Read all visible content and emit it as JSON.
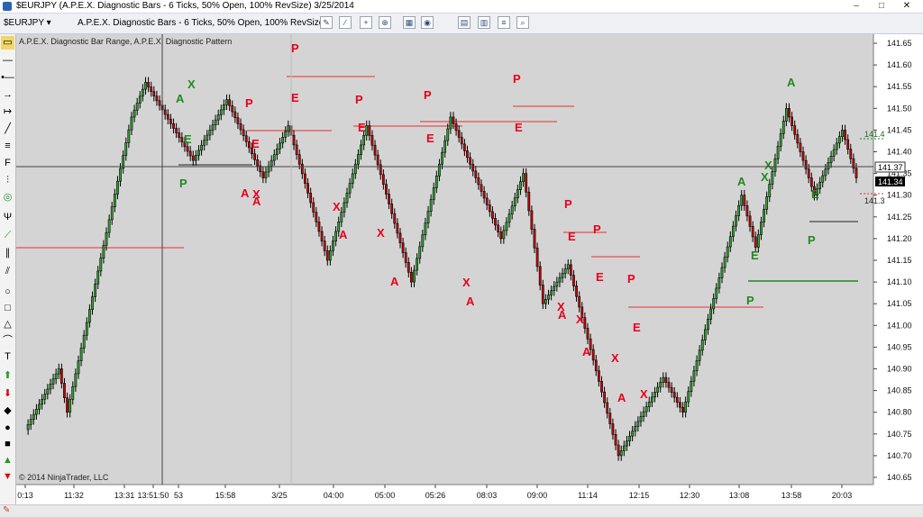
{
  "window": {
    "title": "$EURJPY (A.P.E.X. Diagnostic Bars - 6 Ticks, 50% Open, 100% RevSize)  3/25/2014",
    "minimize": "–",
    "maximize": "□",
    "close": "✕"
  },
  "toolbar": {
    "instrument": "$EURJPY",
    "bar_type": "A.P.E.X. Diagnostic Bars - 6 Ticks, 50% Open, 100% RevSize",
    "dropdown_glyph": "▾",
    "icons": [
      "pencil-icon",
      "wand-icon",
      "crosshair-icon",
      "zoom-icon",
      "data-box-icon",
      "chart-properties-icon",
      "indicators-icon",
      "strategies-icon",
      "lines-icon",
      "magnifier-icon"
    ]
  },
  "sidebar": {
    "tools": [
      "folder-icon",
      "horizontal-line-icon",
      "dots-line-icon",
      "arrow-right-icon",
      "ray-icon",
      "line-icon",
      "equals-icon",
      "fibonacci-icon",
      "gann-fan-icon",
      "circle-target-icon",
      "andrews-pitchfork-icon",
      "regression-channel-icon",
      "parallel-lines-icon",
      "double-line-icon",
      "ellipse-icon",
      "rectangle-icon",
      "triangle-icon",
      "arc-icon",
      "text-icon",
      "arrow-up-icon",
      "arrow-down-icon",
      "diamond-icon",
      "dot-icon",
      "square-icon",
      "triangle-up-icon",
      "triangle-down-icon"
    ]
  },
  "chart": {
    "indicator_label": "A.P.E.X. Diagnostic Bar Range, A.P.E.X. Diagnostic Pattern",
    "copyright": "© 2014 NinjaTrader, LLC",
    "current_price": "141.37",
    "last_price": "141.34",
    "level_label_1": "141.4",
    "level_label_2": "141.3",
    "colors": {
      "background": "#d4d4d4",
      "bull": "#2ea82e",
      "bear": "#cc0000",
      "red_label": "#e8001c",
      "green_label": "#1f8a1f"
    }
  },
  "chart_data": {
    "type": "candlestick",
    "price_axis_ticks": [
      "141.65",
      "141.60",
      "141.55",
      "141.50",
      "141.45",
      "141.40",
      "141.35",
      "141.30",
      "141.25",
      "141.20",
      "141.15",
      "141.10",
      "141.05",
      "141.00",
      "140.95",
      "140.90",
      "140.85",
      "140.80",
      "140.75",
      "140.70",
      "140.65"
    ],
    "time_axis_ticks": [
      "0:13",
      "11:32",
      "13:31",
      "13:51:50",
      "53",
      "15:58",
      "3/25",
      "04:00",
      "05:00",
      "05:26",
      "08:03",
      "09:00",
      "11:14",
      "12:15",
      "12:30",
      "13:08",
      "13:58",
      "20:03"
    ],
    "ylim": [
      140.63,
      141.67
    ],
    "pivots": [
      [
        0,
        140.76
      ],
      [
        12,
        140.9
      ],
      [
        15,
        140.8
      ],
      [
        38,
        141.48
      ],
      [
        43,
        141.56
      ],
      [
        60,
        141.38
      ],
      [
        72,
        141.52
      ],
      [
        85,
        141.34
      ],
      [
        94,
        141.46
      ],
      [
        108,
        141.15
      ],
      [
        122,
        141.46
      ],
      [
        138,
        141.1
      ],
      [
        152,
        141.48
      ],
      [
        170,
        141.2
      ],
      [
        178,
        141.35
      ],
      [
        185,
        141.05
      ],
      [
        194,
        141.14
      ],
      [
        212,
        140.7
      ],
      [
        228,
        140.88
      ],
      [
        235,
        140.8
      ],
      [
        256,
        141.3
      ],
      [
        261,
        141.18
      ],
      [
        272,
        141.5
      ],
      [
        282,
        141.3
      ],
      [
        292,
        141.45
      ],
      [
        297,
        141.34
      ]
    ],
    "labels": [
      {
        "t": "P",
        "c": "red",
        "x": 305,
        "y": 20
      },
      {
        "t": "A",
        "c": "green",
        "x": 177,
        "y": 76
      },
      {
        "t": "X",
        "c": "green",
        "x": 190,
        "y": 60
      },
      {
        "t": "E",
        "c": "green",
        "x": 186,
        "y": 121
      },
      {
        "t": "P",
        "c": "green",
        "x": 181,
        "y": 170
      },
      {
        "t": "P",
        "c": "red",
        "x": 254,
        "y": 81
      },
      {
        "t": "E",
        "c": "red",
        "x": 261,
        "y": 126
      },
      {
        "t": "A",
        "c": "red",
        "x": 249,
        "y": 181
      },
      {
        "t": "X",
        "c": "red",
        "x": 262,
        "y": 182
      },
      {
        "t": "A",
        "c": "red",
        "x": 262,
        "y": 190
      },
      {
        "t": "E",
        "c": "red",
        "x": 305,
        "y": 75
      },
      {
        "t": "P",
        "c": "red",
        "x": 376,
        "y": 77
      },
      {
        "t": "E",
        "c": "red",
        "x": 379,
        "y": 108
      },
      {
        "t": "X",
        "c": "red",
        "x": 351,
        "y": 196
      },
      {
        "t": "A",
        "c": "red",
        "x": 358,
        "y": 227
      },
      {
        "t": "P",
        "c": "red",
        "x": 452,
        "y": 72
      },
      {
        "t": "E",
        "c": "red",
        "x": 455,
        "y": 120
      },
      {
        "t": "X",
        "c": "red",
        "x": 400,
        "y": 225
      },
      {
        "t": "A",
        "c": "red",
        "x": 415,
        "y": 279
      },
      {
        "t": "X",
        "c": "red",
        "x": 495,
        "y": 280
      },
      {
        "t": "A",
        "c": "red",
        "x": 499,
        "y": 301
      },
      {
        "t": "P",
        "c": "red",
        "x": 551,
        "y": 54
      },
      {
        "t": "E",
        "c": "red",
        "x": 553,
        "y": 108
      },
      {
        "t": "P",
        "c": "red",
        "x": 608,
        "y": 193
      },
      {
        "t": "E",
        "c": "red",
        "x": 612,
        "y": 229
      },
      {
        "t": "P",
        "c": "red",
        "x": 640,
        "y": 221
      },
      {
        "t": "E",
        "c": "red",
        "x": 643,
        "y": 274
      },
      {
        "t": "P",
        "c": "red",
        "x": 678,
        "y": 276
      },
      {
        "t": "X",
        "c": "red",
        "x": 600,
        "y": 307
      },
      {
        "t": "A",
        "c": "red",
        "x": 601,
        "y": 316
      },
      {
        "t": "X",
        "c": "red",
        "x": 621,
        "y": 321
      },
      {
        "t": "A",
        "c": "red",
        "x": 628,
        "y": 357
      },
      {
        "t": "E",
        "c": "red",
        "x": 684,
        "y": 330
      },
      {
        "t": "X",
        "c": "red",
        "x": 660,
        "y": 364
      },
      {
        "t": "A",
        "c": "red",
        "x": 667,
        "y": 408
      },
      {
        "t": "X",
        "c": "red",
        "x": 692,
        "y": 404
      },
      {
        "t": "A",
        "c": "green",
        "x": 800,
        "y": 168
      },
      {
        "t": "X",
        "c": "green",
        "x": 830,
        "y": 150
      },
      {
        "t": "X",
        "c": "green",
        "x": 826,
        "y": 163
      },
      {
        "t": "E",
        "c": "green",
        "x": 815,
        "y": 250
      },
      {
        "t": "P",
        "c": "green",
        "x": 810,
        "y": 300
      },
      {
        "t": "A",
        "c": "green",
        "x": 855,
        "y": 58
      },
      {
        "t": "E",
        "c": "green",
        "x": 882,
        "y": 182
      },
      {
        "t": "P",
        "c": "green",
        "x": 878,
        "y": 233
      }
    ],
    "lines": [
      {
        "c": "red",
        "x1": 0,
        "x2": 186,
        "y": 237
      },
      {
        "c": "red",
        "x1": 300,
        "x2": 398,
        "y": 47
      },
      {
        "c": "red",
        "x1": 256,
        "x2": 350,
        "y": 107
      },
      {
        "c": "red",
        "x1": 374,
        "x2": 495,
        "y": 102
      },
      {
        "c": "red",
        "x1": 448,
        "x2": 600,
        "y": 97
      },
      {
        "c": "red",
        "x1": 551,
        "x2": 619,
        "y": 80
      },
      {
        "c": "red",
        "x1": 607,
        "x2": 655,
        "y": 220
      },
      {
        "c": "red",
        "x1": 638,
        "x2": 692,
        "y": 247
      },
      {
        "c": "red",
        "x1": 679,
        "x2": 829,
        "y": 303
      },
      {
        "c": "green",
        "x1": 812,
        "x2": 934,
        "y": 274
      },
      {
        "c": "black",
        "x1": 880,
        "x2": 934,
        "y": 208
      },
      {
        "c": "black",
        "x1": 180,
        "x2": 262,
        "y": 145
      },
      {
        "c": "green",
        "x1": 936,
        "x2": 964,
        "y": 116
      },
      {
        "c": "red",
        "x1": 936,
        "x2": 964,
        "y": 177
      }
    ]
  }
}
